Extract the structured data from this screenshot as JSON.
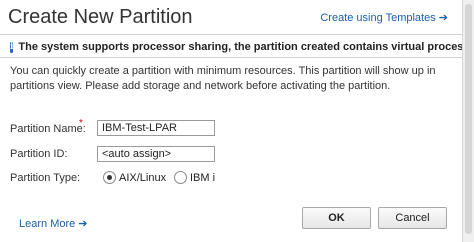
{
  "dialog": {
    "title": "Create New Partition",
    "template_link": "Create using Templates ➔",
    "info_text": "The system supports processor sharing, the partition created contains virtual processors",
    "description": "You can quickly create a partition with minimum resources. This partition will show up in partitions view. Please add storage and network before activating the partition."
  },
  "form": {
    "name_label": "Partition Name:",
    "name_required": "*",
    "name_value": "IBM-Test-LPAR",
    "id_label": "Partition ID:",
    "id_value": "<auto assign>",
    "type_label": "Partition Type:",
    "type_options": [
      "AIX/Linux",
      "IBM i"
    ],
    "type_selected": "AIX/Linux"
  },
  "footer": {
    "learn_more": "Learn More ➔",
    "ok_label": "OK",
    "cancel_label": "Cancel"
  },
  "colors": {
    "link": "#1a5fa8",
    "info_icon": "#2a6ab8",
    "required": "#d00000"
  }
}
